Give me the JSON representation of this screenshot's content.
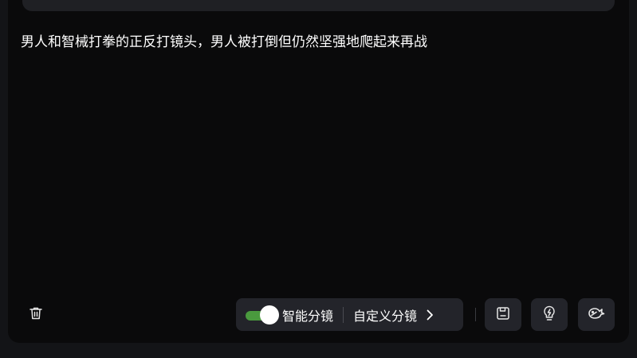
{
  "prompt": {
    "text": "男人和智械打拳的正反打镜头，男人被打倒但仍然坚强地爬起来再战"
  },
  "toolbar": {
    "smart_storyboard_label": "智能分镜",
    "smart_storyboard_enabled": true,
    "custom_storyboard_label": "自定义分镜"
  },
  "icons": {
    "delete": "trash-icon",
    "save": "save-icon",
    "inspiration": "lightbulb-icon",
    "brand": "whale-icon",
    "expand": "chevron-right-icon"
  },
  "colors": {
    "toggle_on": "#4a9a3e",
    "panel_bg": "#0a0a0b",
    "button_bg": "#23242a"
  }
}
